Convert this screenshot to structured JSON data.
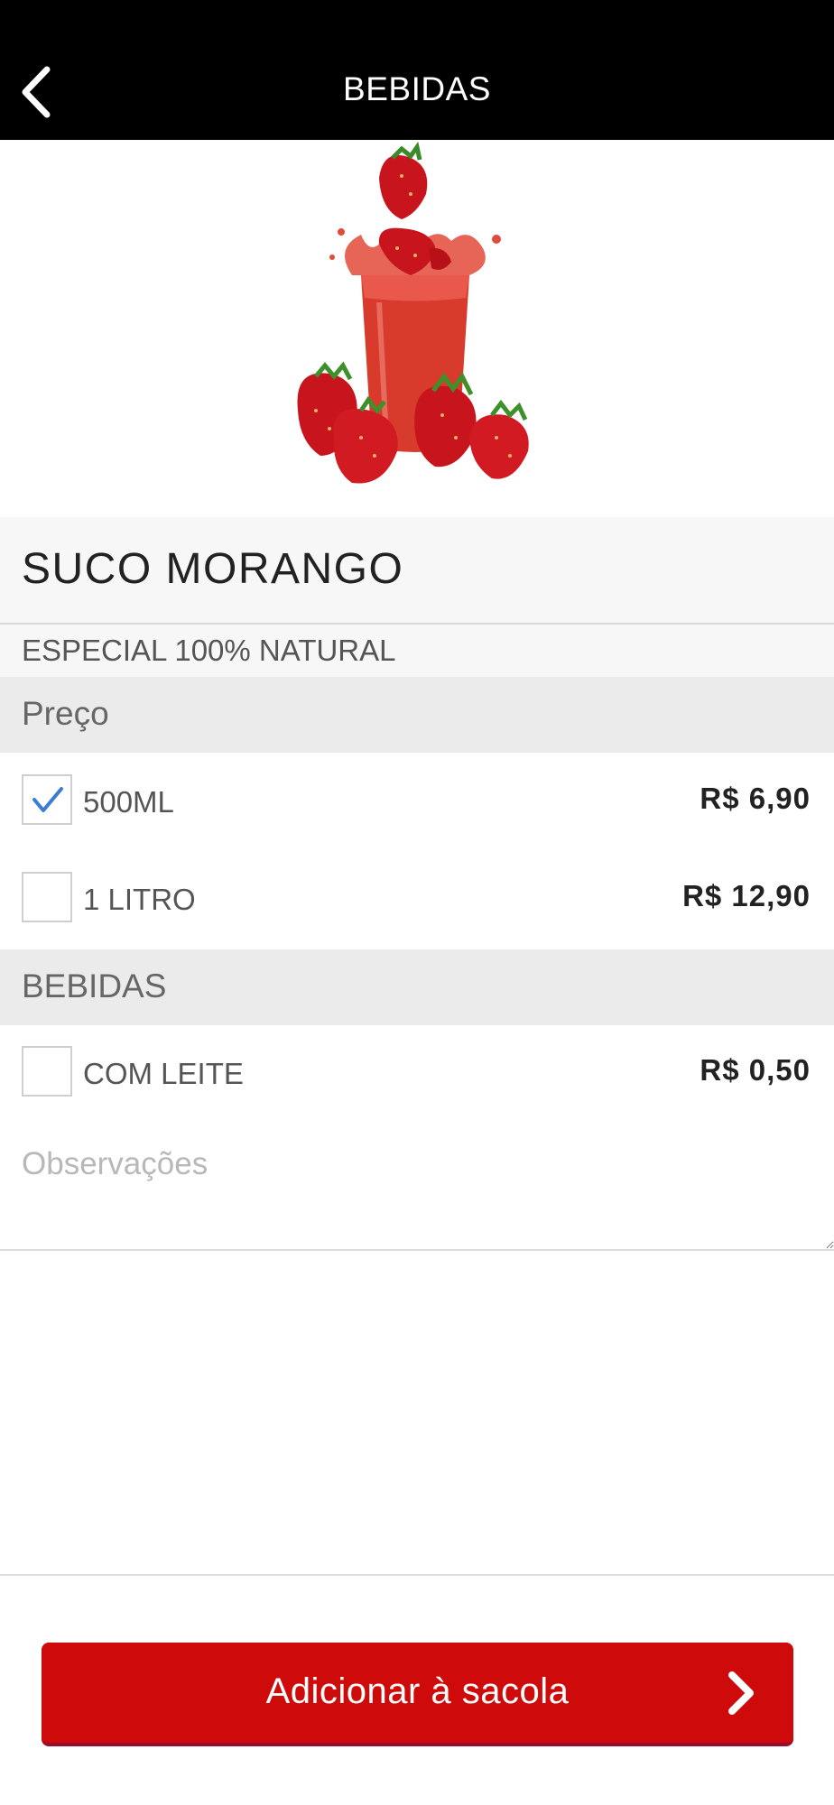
{
  "header": {
    "title": "BEBIDAS"
  },
  "product": {
    "name": "SUCO MORANGO",
    "description": "ESPECIAL 100% NATURAL"
  },
  "sections": {
    "price": {
      "title": "Preço",
      "options": [
        {
          "label": "500ML",
          "price": "R$ 6,90",
          "checked": true
        },
        {
          "label": "1 LITRO",
          "price": "R$ 12,90",
          "checked": false
        }
      ]
    },
    "drinks": {
      "title": "BEBIDAS",
      "options": [
        {
          "label": "COM LEITE",
          "price": "R$ 0,50",
          "checked": false
        }
      ]
    }
  },
  "notes": {
    "placeholder": "Observações"
  },
  "footer": {
    "add_label": "Adicionar à sacola"
  },
  "colors": {
    "header_bg": "#000000",
    "accent_red": "#cf0a0a",
    "check_blue": "#3b7bd4"
  }
}
